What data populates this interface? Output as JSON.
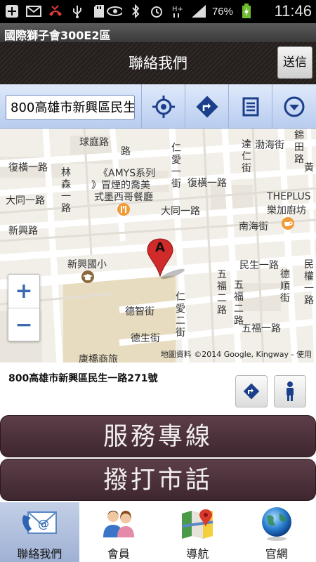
{
  "status_bar": {
    "battery_percent": "76%",
    "time": "11:46"
  },
  "app_title": "國際獅子會300E2區",
  "header": {
    "title": "聯絡我們",
    "send_label": "送信"
  },
  "toolbar": {
    "address_value": "800高雄市新興區民生",
    "buttons": [
      {
        "icon": "locate-icon"
      },
      {
        "icon": "directions-icon"
      },
      {
        "icon": "list-icon"
      },
      {
        "icon": "dropdown-icon"
      }
    ]
  },
  "map": {
    "streets": {
      "qiuting": "球庭路",
      "fuheng1": "復橫一路",
      "datong1": "大同一路",
      "xinxing": "新興路",
      "bohai": "渤海街",
      "nanhai": "南海街",
      "datong1b": "大同一路",
      "fuheng1b": "復橫一路",
      "minsheng1": "民生一路",
      "dezhi": "德智街",
      "desheng": "德生街",
      "wufu1": "五福一路",
      "vertical_lin": "林森一路",
      "vertical_ren": "仁愛一街",
      "vertical_ren2": "仁愛二街",
      "vertical_da": "達仁街",
      "vertical_jin": "錦田路",
      "vertical_wu2": "五福二路",
      "vertical_wu2b": "五福二路",
      "vertical_de": "德順街",
      "vertical_min": "民權一路",
      "huang": "黃",
      "lu": "路",
      "zhuan": "庫"
    },
    "poi": {
      "amys_line1": "《AMYS系列",
      "amys_line2": "》冒煙的喬美",
      "amys_line3": "式墨西哥餐廳",
      "theplus_line1": "THEPLUS",
      "theplus_line2": "樂加廚坊",
      "school": "新興國小",
      "kangqiao": "康橋商旅",
      "marker_letter": "A"
    },
    "zoom_in": "+",
    "zoom_out": "−",
    "attribution": "地圖資料 ©2014 Google, Kingway - 使用"
  },
  "address": {
    "text": "800高雄市新興區民生一路271號"
  },
  "actions": {
    "service_hotline": "服務專線",
    "call_landline": "撥打市話"
  },
  "bottom_nav": [
    {
      "label": "聯絡我們",
      "icon": "contact-mail-icon",
      "active": true
    },
    {
      "label": "會員",
      "icon": "members-icon",
      "active": false
    },
    {
      "label": "導航",
      "icon": "map-navigation-icon",
      "active": false
    },
    {
      "label": "官網",
      "icon": "globe-icon",
      "active": false
    }
  ],
  "colors": {
    "big_button": "#4a303a",
    "toolbar": "#c7d7f3",
    "nav_active": "#b0c0de",
    "marker": "#d02a2a"
  }
}
